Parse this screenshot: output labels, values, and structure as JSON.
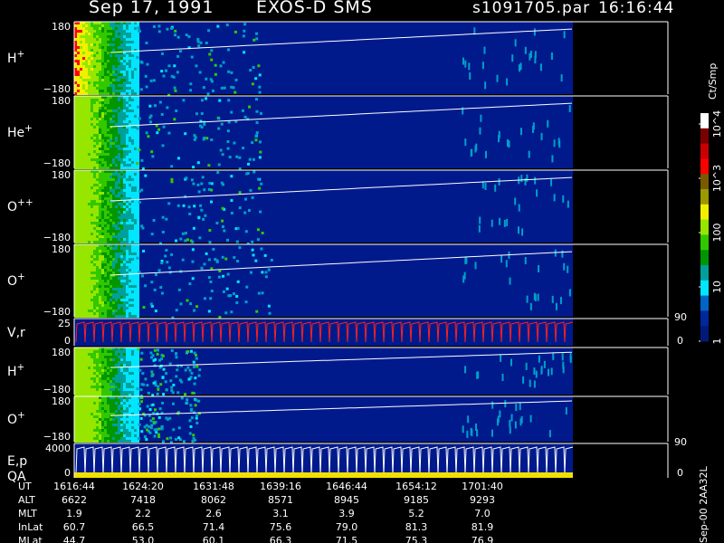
{
  "header": {
    "date": "Sep 17, 1991",
    "instrument": "EXOS-D SMS",
    "file": "s1091705.par",
    "time": "16:16:44"
  },
  "colorbar": {
    "unit_label": "Ct/Smp",
    "ticks": [
      {
        "label": "10^4",
        "value": 10000
      },
      {
        "label": "10^3",
        "value": 1000
      },
      {
        "label": "100",
        "value": 100
      },
      {
        "label": "10",
        "value": 10
      },
      {
        "label": "1",
        "value": 1
      }
    ],
    "colors": [
      "#ffffff",
      "#7a0000",
      "#c80000",
      "#ff0000",
      "#7a5a00",
      "#9a9a00",
      "#f0f000",
      "#96e600",
      "#32c800",
      "#009600",
      "#00a09a",
      "#00e6ff",
      "#0064c8",
      "#00289a",
      "#001a7a"
    ]
  },
  "footer": {
    "rotated_label": "Sep-00  2AA32L"
  },
  "chart_data": {
    "type": "heatmap",
    "panels": [
      {
        "label": "H",
        "sup": "+",
        "ylabel_top": "180",
        "ylabel_bottom": "−180",
        "ylim": [
          -180,
          180
        ]
      },
      {
        "label": "He",
        "sup": "+",
        "ylabel_top": "180",
        "ylabel_bottom": "−180",
        "ylim": [
          -180,
          180
        ]
      },
      {
        "label": "O",
        "sup": "++",
        "ylabel_top": "180",
        "ylabel_bottom": "−180",
        "ylim": [
          -180,
          180
        ]
      },
      {
        "label": "O",
        "sup": "+",
        "ylabel_top": "180",
        "ylabel_bottom": "−180",
        "ylim": [
          -180,
          180
        ]
      },
      {
        "label": "V,r",
        "sup": "",
        "ylabel_top": "25",
        "ylabel_bottom": "0",
        "right_top": "90",
        "right_bottom": "0"
      },
      {
        "label": "H",
        "sup": "+",
        "ylabel_top": "180",
        "ylabel_bottom": "−180",
        "ylim": [
          -180,
          180
        ]
      },
      {
        "label": "O",
        "sup": "+",
        "ylabel_top": "180",
        "ylabel_bottom": "−180",
        "ylim": [
          -180,
          180
        ]
      },
      {
        "label": "E,p",
        "label2": "QA",
        "sup": "",
        "ylabel_top": "4000",
        "ylabel_bottom": "0",
        "right_top": "90",
        "right_bottom": "0"
      }
    ],
    "orbit_table": {
      "rows": [
        {
          "name": "UT",
          "values": [
            "1616:44",
            "1624:20",
            "1631:48",
            "1639:16",
            "1646:44",
            "1654:12",
            "1701:40"
          ]
        },
        {
          "name": "ALT",
          "values": [
            "6622",
            "7418",
            "8062",
            "8571",
            "8945",
            "9185",
            "9293"
          ]
        },
        {
          "name": "MLT",
          "values": [
            "1.9",
            "2.2",
            "2.6",
            "3.1",
            "3.9",
            "5.2",
            "7.0"
          ]
        },
        {
          "name": "InLat",
          "values": [
            "60.7",
            "66.5",
            "71.4",
            "75.6",
            "79.0",
            "81.3",
            "81.9"
          ]
        },
        {
          "name": "MLat",
          "values": [
            "44.7",
            "53.0",
            "60.1",
            "66.3",
            "71.5",
            "75.3",
            "76.9"
          ]
        }
      ]
    }
  }
}
